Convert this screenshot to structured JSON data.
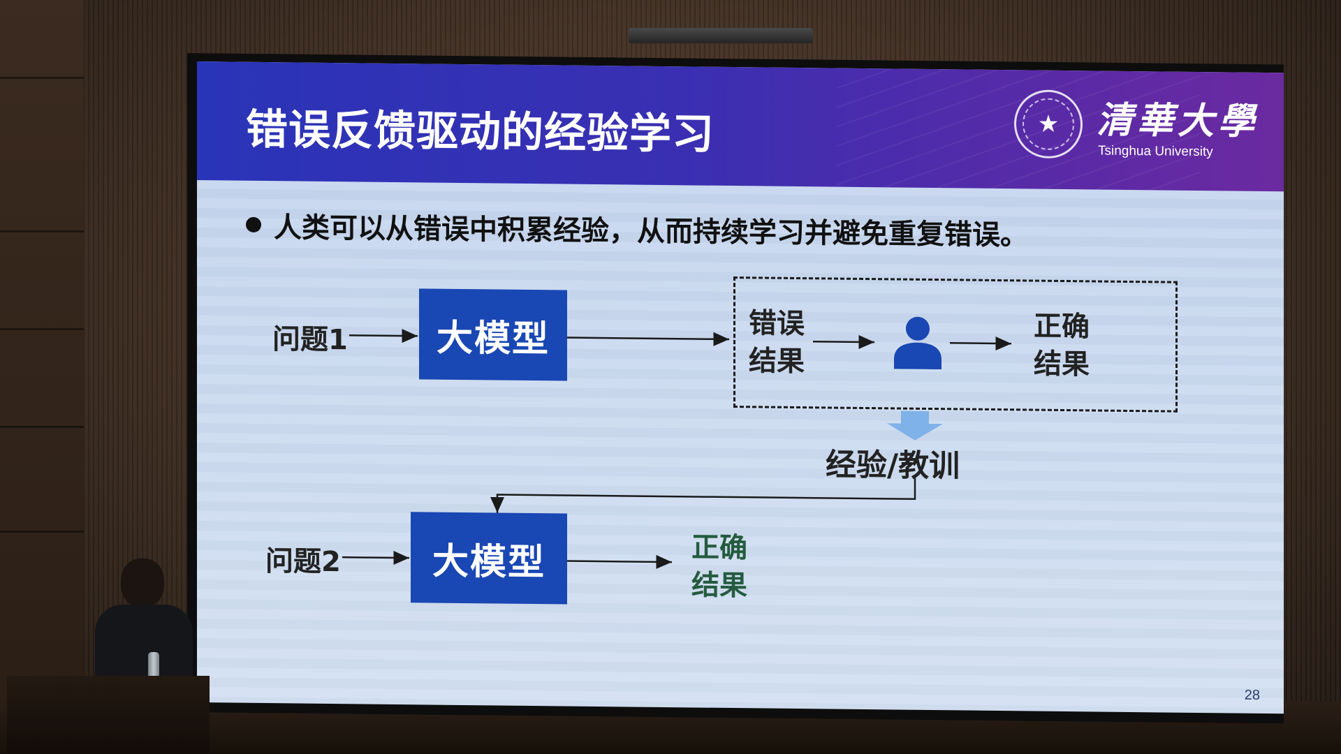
{
  "slide": {
    "title": "错误反馈驱动的经验学习",
    "logo": {
      "name_cn": "清華大學",
      "name_en": "Tsinghua University"
    },
    "bullet": "人类可以从错误中积累经验，从而持续学习并避免重复错误。",
    "row1": {
      "question": "问题1",
      "model": "大模型",
      "wrong_result": [
        "错误",
        "结果"
      ],
      "person_icon": "person-icon",
      "correct_result": [
        "正确",
        "结果"
      ]
    },
    "lesson": "经验/教训",
    "row2": {
      "question": "问题2",
      "model": "大模型",
      "correct_result": [
        "正确",
        "结果"
      ]
    },
    "page_number": "28"
  },
  "colors": {
    "header_start": "#2a34b8",
    "header_end": "#6b2aa0",
    "model_box": "#1947b3",
    "slide_background": "#c8d8ef",
    "feedback_arrow": "#7fb2e8",
    "green_text": "#245b3f"
  }
}
